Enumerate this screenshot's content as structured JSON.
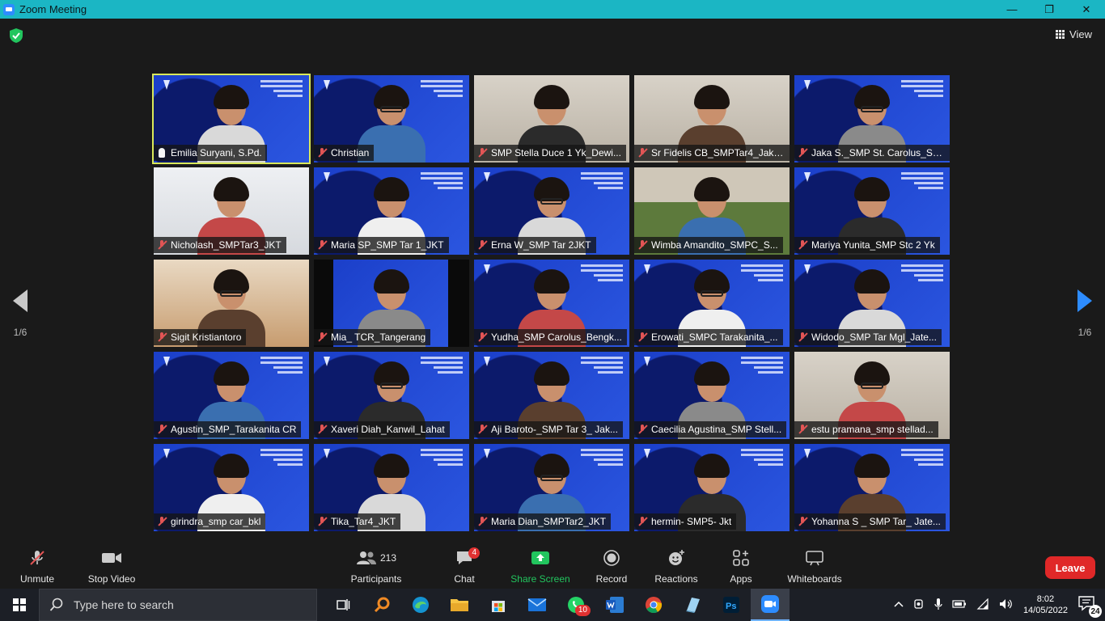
{
  "window": {
    "title": "Zoom Meeting",
    "minimize_glyph": "—",
    "maximize_glyph": "❐",
    "close_glyph": "✕"
  },
  "header": {
    "view_label": "View"
  },
  "pager": {
    "left_label": "1/6",
    "right_label": "1/6"
  },
  "participants_grid": [
    {
      "name": "Emilia Suryani, S.Pd.",
      "bg": "blue",
      "active": true,
      "icon": "raise"
    },
    {
      "name": "Christian",
      "bg": "blue",
      "active": false,
      "icon": "mic"
    },
    {
      "name": "SMP Stella Duce 1 Yk_Dewi...",
      "bg": "room",
      "active": false,
      "icon": "mic"
    },
    {
      "name": "Sr Fidelis CB_SMPTar4_Jaka...",
      "bg": "room",
      "active": false,
      "icon": "mic"
    },
    {
      "name": "Jaka S._SMP St. Carolus_Su...",
      "bg": "blue",
      "active": false,
      "icon": "mic"
    },
    {
      "name": "Nicholash_SMPTar3_JKT",
      "bg": "white",
      "active": false,
      "icon": "mic"
    },
    {
      "name": "Maria SP_SMP Tar 1_JKT",
      "bg": "blue",
      "active": false,
      "icon": "mic"
    },
    {
      "name": "Erna W_SMP Tar 2JKT",
      "bg": "blue",
      "active": false,
      "icon": "mic"
    },
    {
      "name": "Wimba Amandito_SMPC_S...",
      "bg": "green",
      "active": false,
      "icon": "mic"
    },
    {
      "name": "Mariya Yunita_SMP Stc 2 Yk",
      "bg": "blue",
      "active": false,
      "icon": "mic"
    },
    {
      "name": "Sigit Kristiantoro",
      "bg": "slide",
      "active": false,
      "icon": "mic"
    },
    {
      "name": "Mia_ TCR_Tangerang",
      "bg": "black",
      "active": false,
      "icon": "mic"
    },
    {
      "name": "Yudha_SMP Carolus_Bengk...",
      "bg": "blue",
      "active": false,
      "icon": "mic"
    },
    {
      "name": "Erowati_SMPC Tarakanita_...",
      "bg": "blue",
      "active": false,
      "icon": "mic"
    },
    {
      "name": "Widodo_SMP Tar Mgl_Jate...",
      "bg": "blue",
      "active": false,
      "icon": "mic"
    },
    {
      "name": "Agustin_SMP_Tarakanita CR",
      "bg": "blue",
      "active": false,
      "icon": "mic"
    },
    {
      "name": "Xaveri Diah_Kanwil_Lahat",
      "bg": "blue",
      "active": false,
      "icon": "mic"
    },
    {
      "name": "Aji Baroto-_SMP Tar 3_ Jak...",
      "bg": "blue",
      "active": false,
      "icon": "mic"
    },
    {
      "name": "Caecilia Agustina_SMP Stell...",
      "bg": "blue",
      "active": false,
      "icon": "mic"
    },
    {
      "name": "estu pramana_smp stellad...",
      "bg": "room",
      "active": false,
      "icon": "mic"
    },
    {
      "name": "girindra_smp car_bkl",
      "bg": "blue",
      "active": false,
      "icon": "mic"
    },
    {
      "name": "Tika_Tar4_JKT",
      "bg": "blue",
      "active": false,
      "icon": "mic"
    },
    {
      "name": "Maria Dian_SMPTar2_JKT",
      "bg": "blue",
      "active": false,
      "icon": "mic"
    },
    {
      "name": "hermin- SMP5- Jkt",
      "bg": "blue",
      "active": false,
      "icon": "mic"
    },
    {
      "name": "Yohanna S _ SMP Tar_ Jate...",
      "bg": "blue",
      "active": false,
      "icon": "mic"
    }
  ],
  "toolbar": {
    "unmute_label": "Unmute",
    "stop_video_label": "Stop Video",
    "participants_label": "Participants",
    "participants_count": "213",
    "chat_label": "Chat",
    "chat_badge": "4",
    "share_screen_label": "Share Screen",
    "record_label": "Record",
    "reactions_label": "Reactions",
    "apps_label": "Apps",
    "whiteboards_label": "Whiteboards",
    "leave_label": "Leave",
    "share_color": "#22c55e",
    "leave_color": "#e02828"
  },
  "taskbar": {
    "search_placeholder": "Type here to search",
    "whatsapp_badge": "10",
    "time": "8:02",
    "date": "14/05/2022",
    "notification_count": "24"
  }
}
